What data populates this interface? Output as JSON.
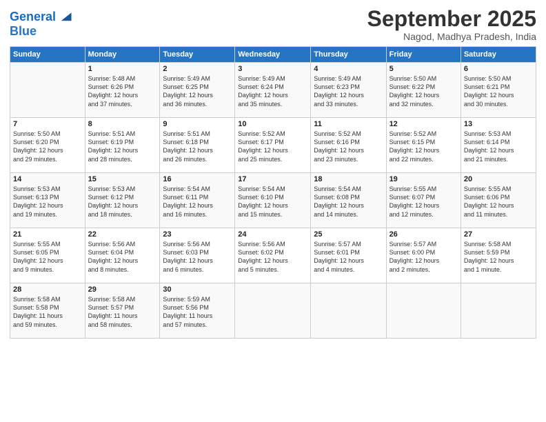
{
  "header": {
    "logo_line1": "General",
    "logo_line2": "Blue",
    "month": "September 2025",
    "location": "Nagod, Madhya Pradesh, India"
  },
  "weekdays": [
    "Sunday",
    "Monday",
    "Tuesday",
    "Wednesday",
    "Thursday",
    "Friday",
    "Saturday"
  ],
  "weeks": [
    [
      {
        "day": "",
        "info": ""
      },
      {
        "day": "1",
        "info": "Sunrise: 5:48 AM\nSunset: 6:26 PM\nDaylight: 12 hours\nand 37 minutes."
      },
      {
        "day": "2",
        "info": "Sunrise: 5:49 AM\nSunset: 6:25 PM\nDaylight: 12 hours\nand 36 minutes."
      },
      {
        "day": "3",
        "info": "Sunrise: 5:49 AM\nSunset: 6:24 PM\nDaylight: 12 hours\nand 35 minutes."
      },
      {
        "day": "4",
        "info": "Sunrise: 5:49 AM\nSunset: 6:23 PM\nDaylight: 12 hours\nand 33 minutes."
      },
      {
        "day": "5",
        "info": "Sunrise: 5:50 AM\nSunset: 6:22 PM\nDaylight: 12 hours\nand 32 minutes."
      },
      {
        "day": "6",
        "info": "Sunrise: 5:50 AM\nSunset: 6:21 PM\nDaylight: 12 hours\nand 30 minutes."
      }
    ],
    [
      {
        "day": "7",
        "info": "Sunrise: 5:50 AM\nSunset: 6:20 PM\nDaylight: 12 hours\nand 29 minutes."
      },
      {
        "day": "8",
        "info": "Sunrise: 5:51 AM\nSunset: 6:19 PM\nDaylight: 12 hours\nand 28 minutes."
      },
      {
        "day": "9",
        "info": "Sunrise: 5:51 AM\nSunset: 6:18 PM\nDaylight: 12 hours\nand 26 minutes."
      },
      {
        "day": "10",
        "info": "Sunrise: 5:52 AM\nSunset: 6:17 PM\nDaylight: 12 hours\nand 25 minutes."
      },
      {
        "day": "11",
        "info": "Sunrise: 5:52 AM\nSunset: 6:16 PM\nDaylight: 12 hours\nand 23 minutes."
      },
      {
        "day": "12",
        "info": "Sunrise: 5:52 AM\nSunset: 6:15 PM\nDaylight: 12 hours\nand 22 minutes."
      },
      {
        "day": "13",
        "info": "Sunrise: 5:53 AM\nSunset: 6:14 PM\nDaylight: 12 hours\nand 21 minutes."
      }
    ],
    [
      {
        "day": "14",
        "info": "Sunrise: 5:53 AM\nSunset: 6:13 PM\nDaylight: 12 hours\nand 19 minutes."
      },
      {
        "day": "15",
        "info": "Sunrise: 5:53 AM\nSunset: 6:12 PM\nDaylight: 12 hours\nand 18 minutes."
      },
      {
        "day": "16",
        "info": "Sunrise: 5:54 AM\nSunset: 6:11 PM\nDaylight: 12 hours\nand 16 minutes."
      },
      {
        "day": "17",
        "info": "Sunrise: 5:54 AM\nSunset: 6:10 PM\nDaylight: 12 hours\nand 15 minutes."
      },
      {
        "day": "18",
        "info": "Sunrise: 5:54 AM\nSunset: 6:08 PM\nDaylight: 12 hours\nand 14 minutes."
      },
      {
        "day": "19",
        "info": "Sunrise: 5:55 AM\nSunset: 6:07 PM\nDaylight: 12 hours\nand 12 minutes."
      },
      {
        "day": "20",
        "info": "Sunrise: 5:55 AM\nSunset: 6:06 PM\nDaylight: 12 hours\nand 11 minutes."
      }
    ],
    [
      {
        "day": "21",
        "info": "Sunrise: 5:55 AM\nSunset: 6:05 PM\nDaylight: 12 hours\nand 9 minutes."
      },
      {
        "day": "22",
        "info": "Sunrise: 5:56 AM\nSunset: 6:04 PM\nDaylight: 12 hours\nand 8 minutes."
      },
      {
        "day": "23",
        "info": "Sunrise: 5:56 AM\nSunset: 6:03 PM\nDaylight: 12 hours\nand 6 minutes."
      },
      {
        "day": "24",
        "info": "Sunrise: 5:56 AM\nSunset: 6:02 PM\nDaylight: 12 hours\nand 5 minutes."
      },
      {
        "day": "25",
        "info": "Sunrise: 5:57 AM\nSunset: 6:01 PM\nDaylight: 12 hours\nand 4 minutes."
      },
      {
        "day": "26",
        "info": "Sunrise: 5:57 AM\nSunset: 6:00 PM\nDaylight: 12 hours\nand 2 minutes."
      },
      {
        "day": "27",
        "info": "Sunrise: 5:58 AM\nSunset: 5:59 PM\nDaylight: 12 hours\nand 1 minute."
      }
    ],
    [
      {
        "day": "28",
        "info": "Sunrise: 5:58 AM\nSunset: 5:58 PM\nDaylight: 11 hours\nand 59 minutes."
      },
      {
        "day": "29",
        "info": "Sunrise: 5:58 AM\nSunset: 5:57 PM\nDaylight: 11 hours\nand 58 minutes."
      },
      {
        "day": "30",
        "info": "Sunrise: 5:59 AM\nSunset: 5:56 PM\nDaylight: 11 hours\nand 57 minutes."
      },
      {
        "day": "",
        "info": ""
      },
      {
        "day": "",
        "info": ""
      },
      {
        "day": "",
        "info": ""
      },
      {
        "day": "",
        "info": ""
      }
    ]
  ]
}
